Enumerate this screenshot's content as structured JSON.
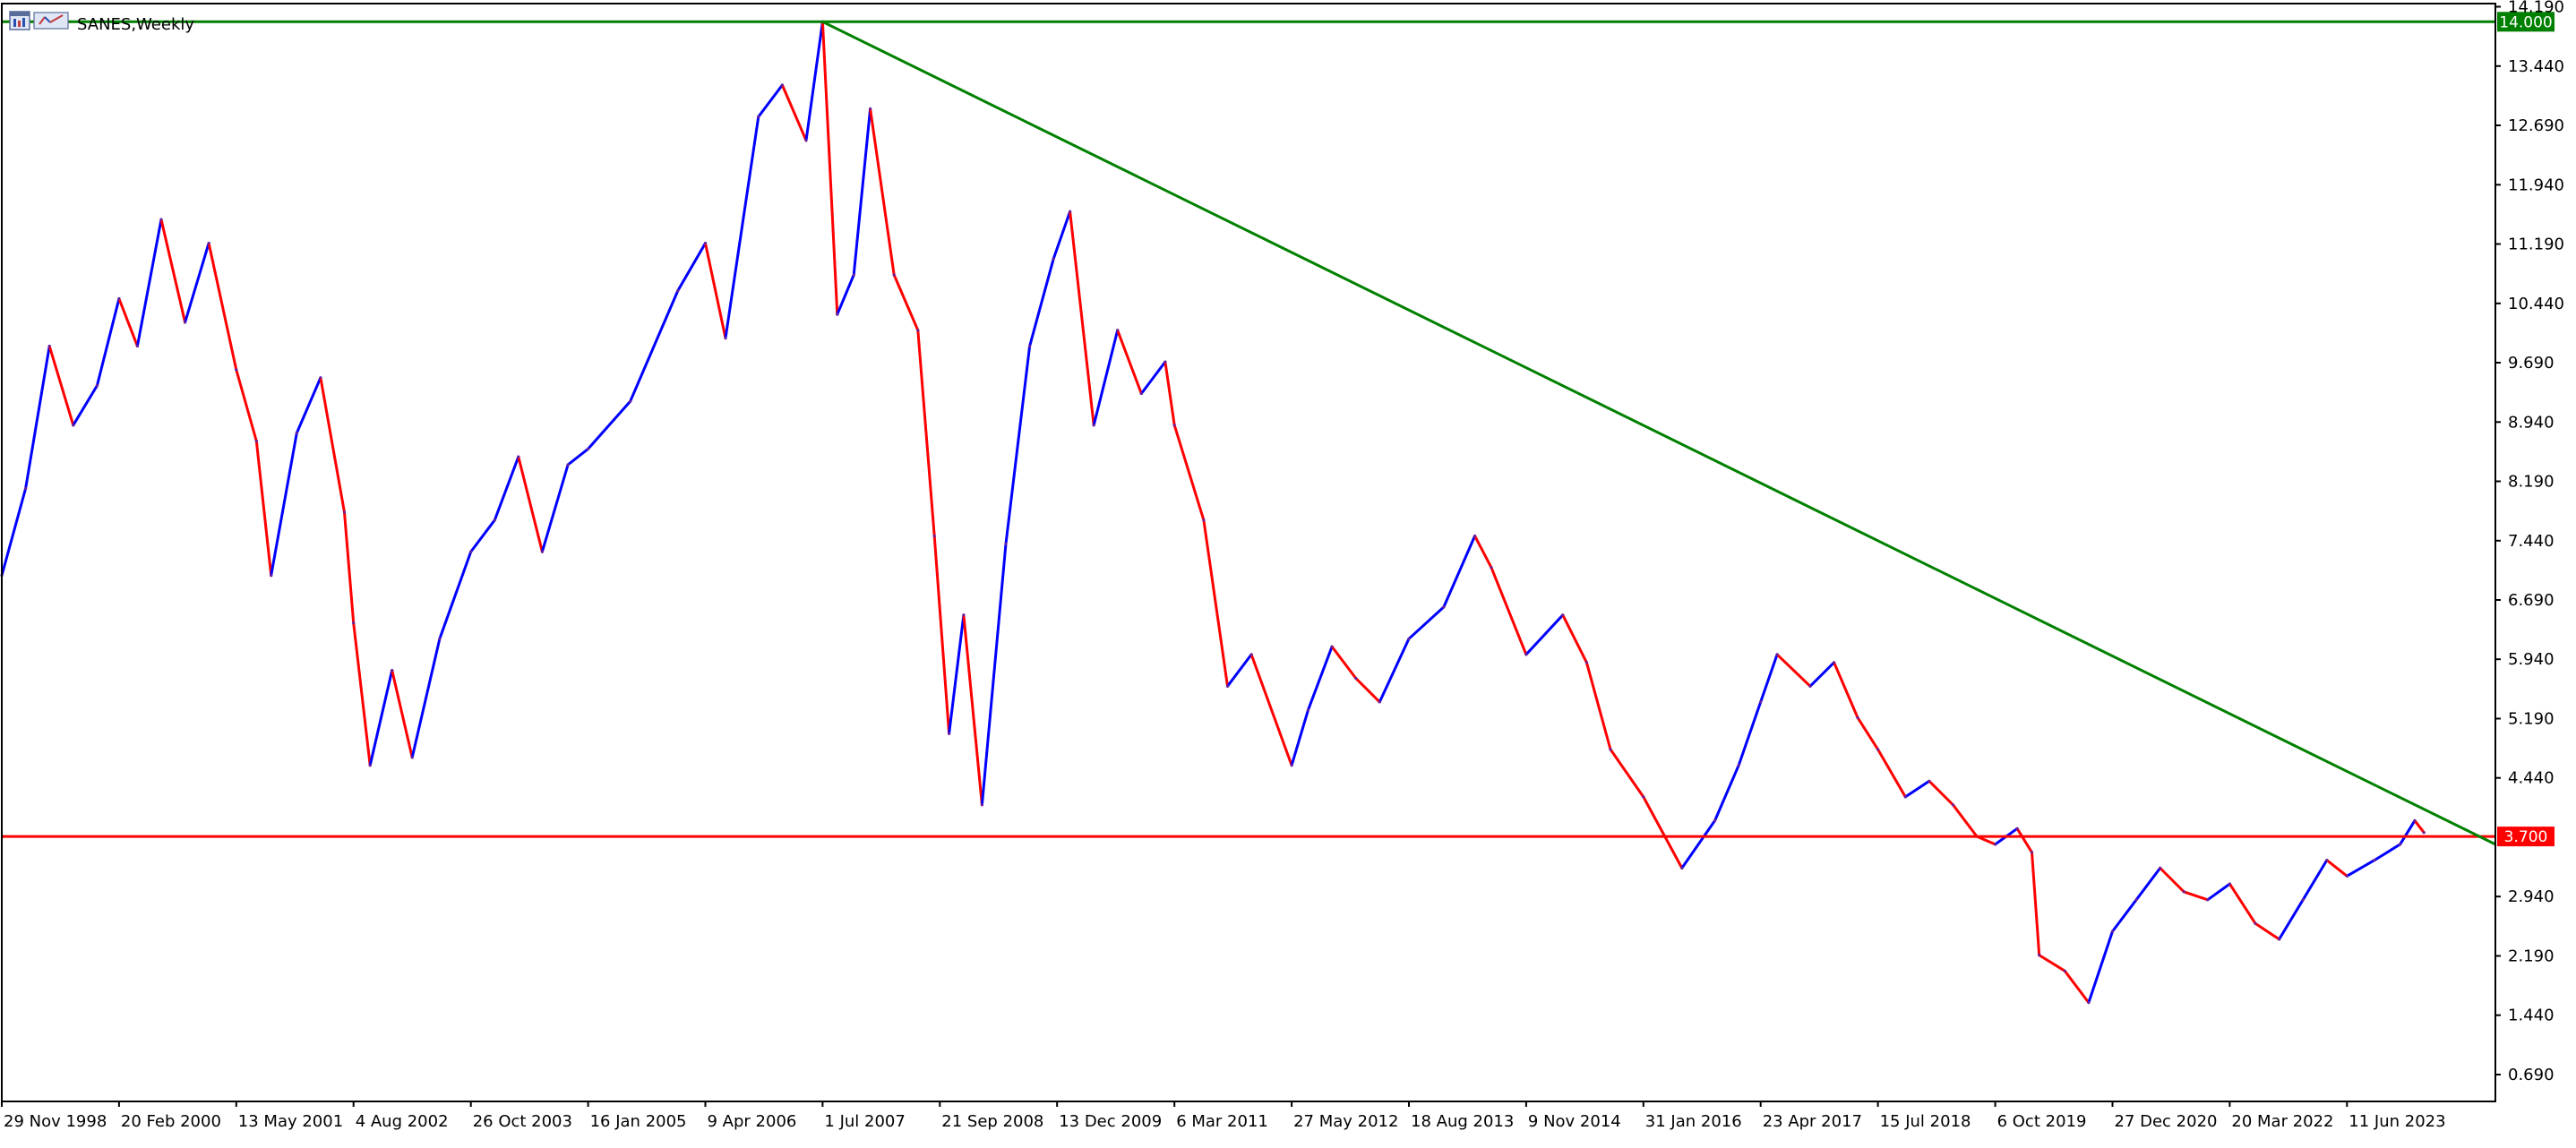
{
  "window": {
    "title": "SANES,Weekly"
  },
  "colors": {
    "background": "#ffffff",
    "frame": "#000000",
    "bull": "#0000ff",
    "bear": "#ff0000",
    "resistance": "#008000",
    "support": "#ff0000",
    "trendline": "#008000",
    "tag_text": "#ffffff"
  },
  "icons": [
    "chart-window-icon"
  ],
  "chart_data": {
    "type": "line",
    "symbol": "SANES",
    "timeframe": "Weekly",
    "title": "SANES,Weekly",
    "xlabel": "",
    "ylabel": "",
    "grid": false,
    "ylim": [
      0.35,
      14.23
    ],
    "xlim": [
      "1998-11-29",
      "2024-12-29"
    ],
    "x_ticks": [
      "29 Nov 1998",
      "20 Feb 2000",
      "13 May 2001",
      "4 Aug 2002",
      "26 Oct 2003",
      "16 Jan 2005",
      "9 Apr 2006",
      "1 Jul 2007",
      "21 Sep 2008",
      "13 Dec 2009",
      "6 Mar 2011",
      "27 May 2012",
      "18 Aug 2013",
      "9 Nov 2014",
      "31 Jan 2016",
      "23 Apr 2017",
      "15 Jul 2018",
      "6 Oct 2019",
      "27 Dec 2020",
      "20 Mar 2022",
      "11 Jun 2023"
    ],
    "y_ticks": [
      "14.190",
      "13.440",
      "12.690",
      "11.940",
      "11.190",
      "10.440",
      "9.690",
      "8.940",
      "8.190",
      "7.440",
      "6.690",
      "5.940",
      "5.190",
      "4.440",
      "3.700",
      "2.940",
      "2.190",
      "1.440",
      "0.690"
    ],
    "series": [
      {
        "values": [
          {
            "x": "1998-11-29",
            "y": 7.0
          },
          {
            "x": "1999-02-28",
            "y": 8.1
          },
          {
            "x": "1999-05-30",
            "y": 9.9
          },
          {
            "x": "1999-08-29",
            "y": 8.9
          },
          {
            "x": "1999-11-28",
            "y": 9.4
          },
          {
            "x": "2000-02-20",
            "y": 10.5
          },
          {
            "x": "2000-04-30",
            "y": 9.9
          },
          {
            "x": "2000-07-30",
            "y": 11.5
          },
          {
            "x": "2000-10-29",
            "y": 10.2
          },
          {
            "x": "2001-01-28",
            "y": 11.2
          },
          {
            "x": "2001-05-13",
            "y": 9.6
          },
          {
            "x": "2001-07-29",
            "y": 8.7
          },
          {
            "x": "2001-09-23",
            "y": 7.0
          },
          {
            "x": "2001-12-30",
            "y": 8.8
          },
          {
            "x": "2002-03-31",
            "y": 9.5
          },
          {
            "x": "2002-06-30",
            "y": 7.8
          },
          {
            "x": "2002-08-04",
            "y": 6.4
          },
          {
            "x": "2002-10-06",
            "y": 4.6
          },
          {
            "x": "2002-12-29",
            "y": 5.8
          },
          {
            "x": "2003-03-16",
            "y": 4.7
          },
          {
            "x": "2003-06-29",
            "y": 6.2
          },
          {
            "x": "2003-10-26",
            "y": 7.3
          },
          {
            "x": "2004-01-25",
            "y": 7.7
          },
          {
            "x": "2004-04-25",
            "y": 8.5
          },
          {
            "x": "2004-07-25",
            "y": 7.3
          },
          {
            "x": "2004-10-31",
            "y": 8.4
          },
          {
            "x": "2005-01-16",
            "y": 8.6
          },
          {
            "x": "2005-06-26",
            "y": 9.2
          },
          {
            "x": "2005-12-25",
            "y": 10.6
          },
          {
            "x": "2006-04-09",
            "y": 11.2
          },
          {
            "x": "2006-06-25",
            "y": 10.0
          },
          {
            "x": "2006-10-29",
            "y": 12.8
          },
          {
            "x": "2007-01-28",
            "y": 13.2
          },
          {
            "x": "2007-04-29",
            "y": 12.5
          },
          {
            "x": "2007-07-01",
            "y": 14.0
          },
          {
            "x": "2007-08-26",
            "y": 10.3
          },
          {
            "x": "2007-10-28",
            "y": 10.8
          },
          {
            "x": "2007-12-30",
            "y": 12.9
          },
          {
            "x": "2008-03-30",
            "y": 10.8
          },
          {
            "x": "2008-06-29",
            "y": 10.1
          },
          {
            "x": "2008-08-31",
            "y": 7.5
          },
          {
            "x": "2008-10-26",
            "y": 5.0
          },
          {
            "x": "2008-12-21",
            "y": 6.5
          },
          {
            "x": "2009-03-01",
            "y": 4.1
          },
          {
            "x": "2009-05-31",
            "y": 7.4
          },
          {
            "x": "2009-08-30",
            "y": 9.9
          },
          {
            "x": "2009-11-29",
            "y": 11.0
          },
          {
            "x": "2010-01-31",
            "y": 11.6
          },
          {
            "x": "2010-05-02",
            "y": 8.9
          },
          {
            "x": "2010-08-01",
            "y": 10.1
          },
          {
            "x": "2010-10-31",
            "y": 9.3
          },
          {
            "x": "2011-01-30",
            "y": 9.7
          },
          {
            "x": "2011-03-06",
            "y": 8.9
          },
          {
            "x": "2011-06-26",
            "y": 7.7
          },
          {
            "x": "2011-09-25",
            "y": 5.6
          },
          {
            "x": "2011-12-25",
            "y": 6.0
          },
          {
            "x": "2012-05-27",
            "y": 4.6
          },
          {
            "x": "2012-07-29",
            "y": 5.3
          },
          {
            "x": "2012-10-28",
            "y": 6.1
          },
          {
            "x": "2013-01-27",
            "y": 5.7
          },
          {
            "x": "2013-04-28",
            "y": 5.4
          },
          {
            "x": "2013-08-18",
            "y": 6.2
          },
          {
            "x": "2013-12-29",
            "y": 6.6
          },
          {
            "x": "2014-04-27",
            "y": 7.5
          },
          {
            "x": "2014-06-29",
            "y": 7.1
          },
          {
            "x": "2014-11-09",
            "y": 6.0
          },
          {
            "x": "2015-03-29",
            "y": 6.5
          },
          {
            "x": "2015-06-28",
            "y": 5.9
          },
          {
            "x": "2015-09-27",
            "y": 4.8
          },
          {
            "x": "2016-01-31",
            "y": 4.2
          },
          {
            "x": "2016-06-26",
            "y": 3.3
          },
          {
            "x": "2016-10-30",
            "y": 3.9
          },
          {
            "x": "2017-01-29",
            "y": 4.6
          },
          {
            "x": "2017-04-23",
            "y": 5.4
          },
          {
            "x": "2017-06-25",
            "y": 6.0
          },
          {
            "x": "2017-10-29",
            "y": 5.6
          },
          {
            "x": "2018-01-28",
            "y": 5.9
          },
          {
            "x": "2018-04-29",
            "y": 5.2
          },
          {
            "x": "2018-07-15",
            "y": 4.8
          },
          {
            "x": "2018-10-28",
            "y": 4.2
          },
          {
            "x": "2019-01-27",
            "y": 4.4
          },
          {
            "x": "2019-04-28",
            "y": 4.1
          },
          {
            "x": "2019-07-28",
            "y": 3.7
          },
          {
            "x": "2019-10-06",
            "y": 3.6
          },
          {
            "x": "2019-12-29",
            "y": 3.8
          },
          {
            "x": "2020-02-23",
            "y": 3.5
          },
          {
            "x": "2020-03-22",
            "y": 2.2
          },
          {
            "x": "2020-06-28",
            "y": 2.0
          },
          {
            "x": "2020-09-27",
            "y": 1.6
          },
          {
            "x": "2020-12-27",
            "y": 2.5
          },
          {
            "x": "2021-03-28",
            "y": 2.9
          },
          {
            "x": "2021-06-27",
            "y": 3.3
          },
          {
            "x": "2021-09-26",
            "y": 3.0
          },
          {
            "x": "2021-12-26",
            "y": 2.9
          },
          {
            "x": "2022-03-20",
            "y": 3.1
          },
          {
            "x": "2022-06-26",
            "y": 2.6
          },
          {
            "x": "2022-09-25",
            "y": 2.4
          },
          {
            "x": "2022-12-25",
            "y": 2.9
          },
          {
            "x": "2023-03-26",
            "y": 3.4
          },
          {
            "x": "2023-06-11",
            "y": 3.2
          },
          {
            "x": "2023-09-24",
            "y": 3.4
          },
          {
            "x": "2023-12-31",
            "y": 3.6
          },
          {
            "x": "2024-02-25",
            "y": 3.9
          },
          {
            "x": "2024-03-31",
            "y": 3.75
          }
        ]
      }
    ],
    "horizontal_lines": [
      {
        "label": "14.000",
        "value": 14.0,
        "color": "#008000"
      },
      {
        "label": "3.700",
        "value": 3.7,
        "color": "#ff0000"
      }
    ],
    "trendline": {
      "color": "#008000",
      "from": {
        "x": "2007-07-01",
        "y": 14.0
      },
      "to": {
        "x": "2024-12-29",
        "y": 3.6
      }
    }
  }
}
